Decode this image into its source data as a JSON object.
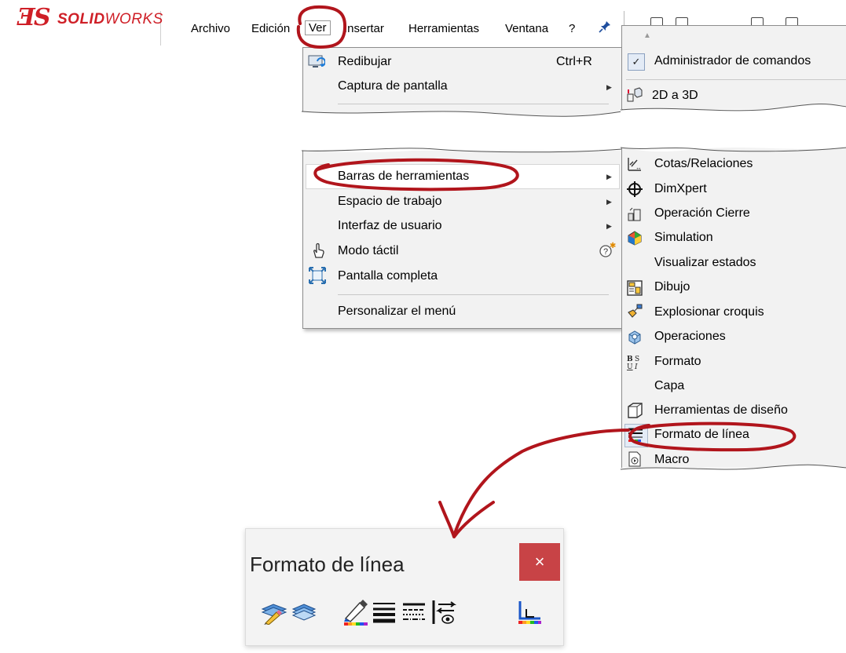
{
  "app": {
    "logo_ds": "ƎS",
    "logo_prefix": "SOLID",
    "logo_suffix": "WORKS"
  },
  "menubar": {
    "items": [
      "Archivo",
      "Edición",
      "Ver",
      "Insertar",
      "Herramientas",
      "Ventana",
      "?"
    ],
    "pin_icon": "pin-icon"
  },
  "ver_menu": {
    "top_items": [
      {
        "label": "Redibujar",
        "shortcut": "Ctrl+R",
        "icon": "redraw-icon"
      },
      {
        "label": "Captura de pantalla",
        "submenu": true
      }
    ],
    "bottom_items": [
      {
        "label": "Barras de herramientas",
        "submenu": true
      },
      {
        "label": "Espacio de trabajo",
        "submenu": true
      },
      {
        "label": "Interfaz de usuario",
        "submenu": true
      },
      {
        "label": "Modo táctil",
        "icon": "touch-icon",
        "help_icon": true
      },
      {
        "label": "Pantalla completa",
        "icon": "fullscreen-icon"
      },
      {
        "label": "Personalizar el menú"
      }
    ]
  },
  "toolbars_submenu": {
    "top_items": [
      {
        "label": "Administrador de comandos",
        "checked": true
      },
      {
        "label": "2D a 3D",
        "icon": "2d-to-3d-icon"
      }
    ],
    "items": [
      {
        "label": "Cotas/Relaciones",
        "icon": "dimension-icon"
      },
      {
        "label": "DimXpert",
        "icon": "crosshair-icon"
      },
      {
        "label": "Operación Cierre",
        "icon": "closure-icon"
      },
      {
        "label": "Simulation",
        "icon": "simulation-icon"
      },
      {
        "label": "Visualizar estados"
      },
      {
        "label": "Dibujo",
        "icon": "drawing-icon"
      },
      {
        "label": "Explosionar croquis",
        "icon": "explode-icon"
      },
      {
        "label": "Operaciones",
        "icon": "features-icon"
      },
      {
        "label": "Formato",
        "icon": "format-icon"
      },
      {
        "label": "Capa"
      },
      {
        "label": "Herramientas de diseño",
        "icon": "design-tools-icon"
      },
      {
        "label": "Formato de línea",
        "icon": "line-format-icon"
      },
      {
        "label": "Macro",
        "icon": "macro-icon"
      }
    ]
  },
  "floating_toolbar": {
    "title": "Formato de línea",
    "close_label": "×",
    "buttons": [
      "layer-properties-icon",
      "change-layer-icon",
      "line-color-icon",
      "line-thickness-icon",
      "line-style-icon",
      "hide-show-edges-icon",
      "color-display-mode-icon"
    ]
  },
  "colors": {
    "annotation_red": "#b1151c",
    "brand_red": "#cf1f27",
    "close_red": "#c84346"
  }
}
